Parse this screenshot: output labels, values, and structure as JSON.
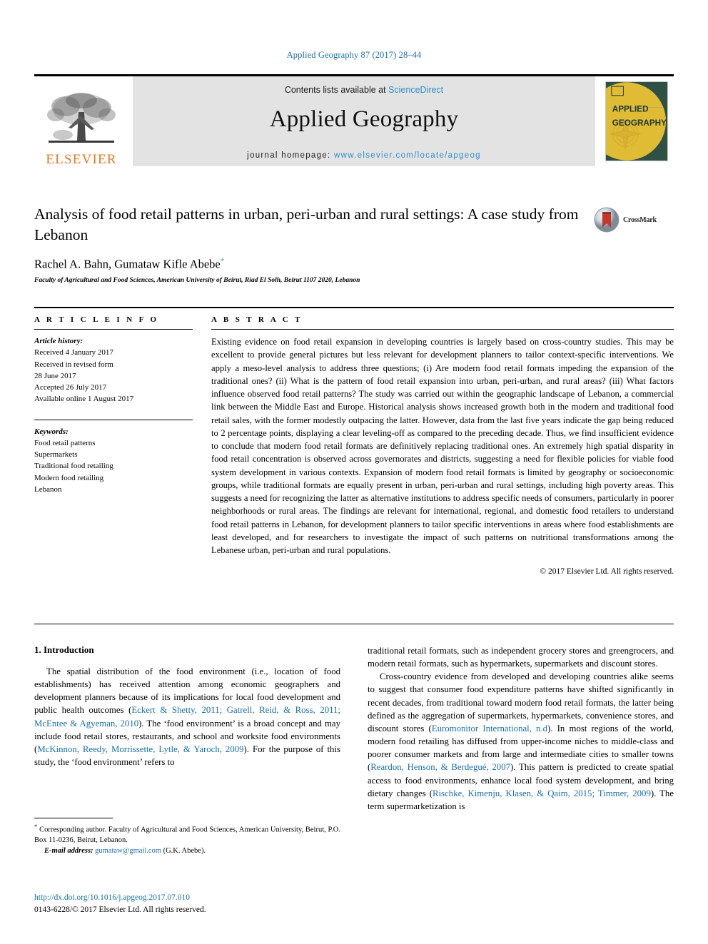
{
  "running_head": "Applied Geography 87 (2017) 28–44",
  "masthead": {
    "publisher_name": "ELSEVIER",
    "contents_prefix": "Contents lists available at ",
    "contents_link": "ScienceDirect",
    "journal_name": "Applied Geography",
    "homepage_prefix": "journal homepage: ",
    "homepage_url": "www.elsevier.com/locate/apgeog",
    "cover_title_line1": "APPLIED",
    "cover_title_line2": "GEOGRAPHY"
  },
  "article": {
    "title": "Analysis of food retail patterns in urban, peri-urban and rural settings: A case study from Lebanon",
    "authors": "Rachel A. Bahn, Gumataw Kifle Abebe",
    "author_marker": "*",
    "affiliation": "Faculty of Agricultural and Food Sciences, American University of Beirut, Riad El Solh, Beirut 1107 2020, Lebanon",
    "crossmark_label": "CrossMark"
  },
  "article_info": {
    "heading": "A R T I C L E  I N F O",
    "history_label": "Article history:",
    "history": [
      "Received 4 January 2017",
      "Received in revised form",
      "28 June 2017",
      "Accepted 26 July 2017",
      "Available online 1 August 2017"
    ],
    "keywords_label": "Keywords:",
    "keywords": [
      "Food retail patterns",
      "Supermarkets",
      "Traditional food retailing",
      "Modern food retailing",
      "Lebanon"
    ]
  },
  "abstract": {
    "heading": "A B S T R A C T",
    "text": "Existing evidence on food retail expansion in developing countries is largely based on cross-country studies. This may be excellent to provide general pictures but less relevant for development planners to tailor context-specific interventions. We apply a meso-level analysis to address three questions; (i) Are modern food retail formats impeding the expansion of the traditional ones? (ii) What is the pattern of food retail expansion into urban, peri-urban, and rural areas? (iii) What factors influence observed food retail patterns? The study was carried out within the geographic landscape of Lebanon, a commercial link between the Middle East and Europe. Historical analysis shows increased growth both in the modern and traditional food retail sales, with the former modestly outpacing the latter. However, data from the last five years indicate the gap being reduced to 2 percentage points, displaying a clear leveling-off as compared to the preceding decade. Thus, we find insufficient evidence to conclude that modern food retail formats are definitively replacing traditional ones. An extremely high spatial disparity in food retail concentration is observed across governorates and districts, suggesting a need for flexible policies for viable food system development in various contexts. Expansion of modern food retail formats is limited by geography or socioeconomic groups, while traditional formats are equally present in urban, peri-urban and rural settings, including high poverty areas. This suggests a need for recognizing the latter as alternative institutions to address specific needs of consumers, particularly in poorer neighborhoods or rural areas. The findings are relevant for international, regional, and domestic food retailers to understand food retail patterns in Lebanon, for development planners to tailor specific interventions in areas where food establishments are least developed, and for researchers to investigate the impact of such patterns on nutritional transformations among the Lebanese urban, peri-urban and rural populations.",
    "copyright": "© 2017 Elsevier Ltd. All rights reserved."
  },
  "body": {
    "section_number_title": "1. Introduction",
    "left_paragraph_1_pre": "The spatial distribution of the food environment (i.e., location of food establishments) has received attention among economic geographers and development planners because of its implications for local food development and public health outcomes (",
    "left_cite_1": "Eckert & Shetty, 2011; Gatrell, Reid, & Ross, 2011; McEntee & Agyeman, 2010",
    "left_paragraph_1_mid": "). The ‘food environment’ is a broad concept and may include food retail stores, restaurants, and school and worksite food environments (",
    "left_cite_2": "McKinnon, Reedy, Morrissette, Lytle, & Yaroch, 2009",
    "left_paragraph_1_post": "). For the purpose of this study, the ‘food environment’ refers to",
    "right_paragraph_1": "traditional retail formats, such as independent grocery stores and greengrocers, and modern retail formats, such as hypermarkets, supermarkets and discount stores.",
    "right_paragraph_2_pre": "Cross-country evidence from developed and developing countries alike seems to suggest that consumer food expenditure patterns have shifted significantly in recent decades, from traditional toward modern food retail formats, the latter being defined as the aggregation of supermarkets, hypermarkets, convenience stores, and discount stores (",
    "right_cite_1": "Euromonitor International, n.d",
    "right_paragraph_2_mid": "). In most regions of the world, modern food retailing has diffused from upper-income niches to middle-class and poorer consumer markets and from large and intermediate cities to smaller towns (",
    "right_cite_2": "Reardon, Henson, & Berdegué, 2007",
    "right_paragraph_2_mid2": "). This pattern is predicted to create spatial access to food environments, enhance local food system development, and bring dietary changes (",
    "right_cite_3": "Rischke, Kimenju, Klasen, & Qaim, 2015; Timmer, 2009",
    "right_paragraph_2_post": "). The term supermarketization is"
  },
  "footnote": {
    "marker": "*",
    "corresponding": "Corresponding author. Faculty of Agricultural and Food Sciences, American University, Beirut, P.O. Box 11-0236, Beirut, Lebanon.",
    "email_label": "E-mail address:",
    "email": "gumataw@gmail.com",
    "email_owner": "(G.K. Abebe)."
  },
  "footer": {
    "doi": "http://dx.doi.org/10.1016/j.apgeog.2017.07.010",
    "issn_copyright": "0143-6228/© 2017 Elsevier Ltd. All rights reserved."
  },
  "colors": {
    "link": "#1a6ea8",
    "sciencedirect": "#2e8fce",
    "elsevier_orange": "#E87722",
    "header_band": "#e3e3e3"
  }
}
